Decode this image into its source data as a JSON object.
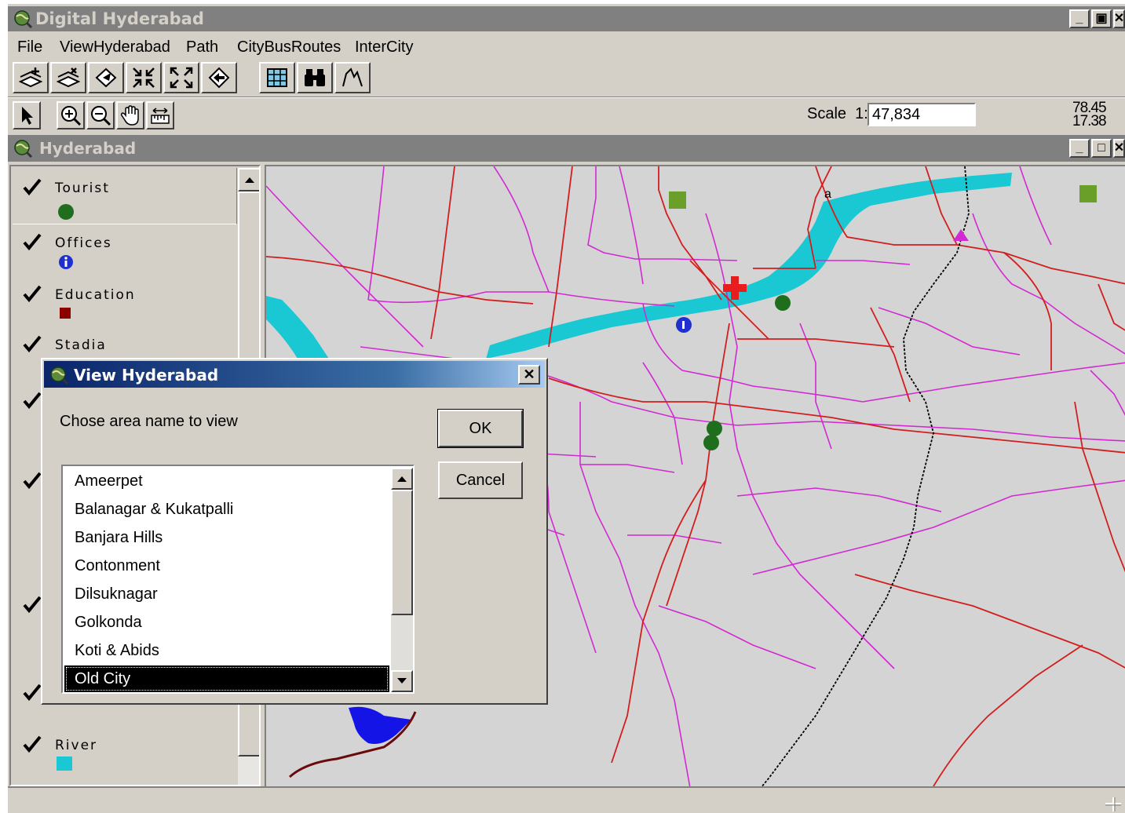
{
  "app": {
    "title": "Digital Hyderabad"
  },
  "menu": [
    {
      "label": "File"
    },
    {
      "label": "ViewHyderabad"
    },
    {
      "label": "Path"
    },
    {
      "label": "CityBusRoutes"
    },
    {
      "label": "InterCity"
    }
  ],
  "toolbar": {
    "scale_label": "Scale",
    "scale_prefix": "1:",
    "scale_value": "47,834",
    "coord_x": "78.45",
    "coord_y": "17.38"
  },
  "map_window": {
    "title": "Hyderabad"
  },
  "legend": [
    {
      "label": "Tourist",
      "symbol": "green-dot",
      "color": "#1e6e1e"
    },
    {
      "label": "Offices",
      "symbol": "info-icon",
      "color": "#1f2fd0"
    },
    {
      "label": "Education",
      "symbol": "square",
      "color": "#8b0000"
    },
    {
      "label": "Stadia",
      "symbol": "",
      "color": ""
    },
    {
      "label": "River",
      "symbol": "square",
      "color": "#19c8d2"
    }
  ],
  "dialog": {
    "title": "View Hyderabad",
    "prompt": "Chose area name to view",
    "ok_label": "OK",
    "cancel_label": "Cancel",
    "items": [
      "Ameerpet",
      "Balanagar & Kukatpalli",
      "Banjara Hills",
      "Contonment",
      "Dilsuknagar",
      "Golkonda",
      "Koti & Abids",
      "Old City"
    ],
    "selected": "Old City"
  },
  "map_labels": {
    "a_label": "a"
  },
  "colors": {
    "road_major": "#d21e1e",
    "road_minor": "#d22ad2",
    "river": "#19c8d2",
    "lake": "#1414e6",
    "railway": "#000000"
  }
}
